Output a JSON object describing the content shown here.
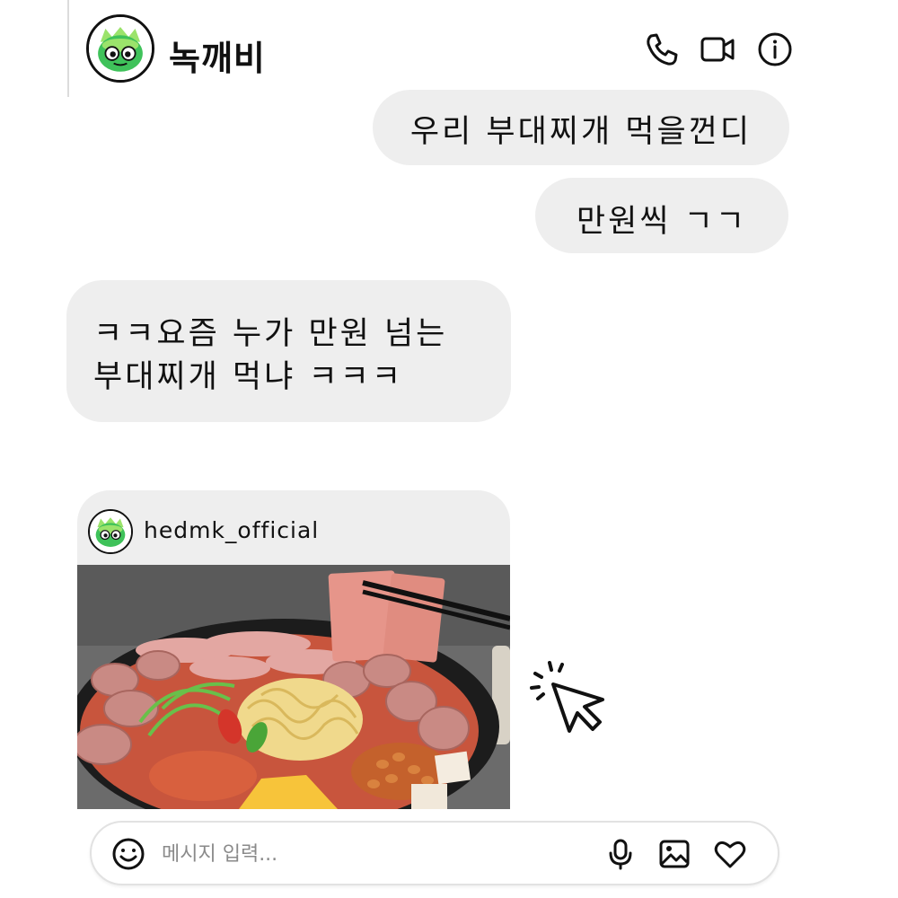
{
  "header": {
    "title": "녹깨비",
    "icons": [
      "phone-icon",
      "video-camera-icon",
      "info-icon"
    ]
  },
  "messages": {
    "sent": [
      {
        "text": "우리 부대찌개 먹을껀디"
      },
      {
        "text": "만원씩 ㄱㄱ"
      }
    ],
    "received": [
      {
        "lines": [
          "ㅋㅋ요즘 누가 만원 넘는",
          "부대찌개 먹냐 ㅋㅋㅋ"
        ]
      }
    ]
  },
  "shared_post": {
    "handle": "hedmk_official"
  },
  "composer": {
    "placeholder": "메시지 입력...",
    "icons": [
      "emoji-icon",
      "microphone-icon",
      "image-icon",
      "heart-icon"
    ]
  },
  "colors": {
    "bubble": "#eeeeee",
    "avatar_green": "#3fc25a",
    "text": "#111111"
  }
}
